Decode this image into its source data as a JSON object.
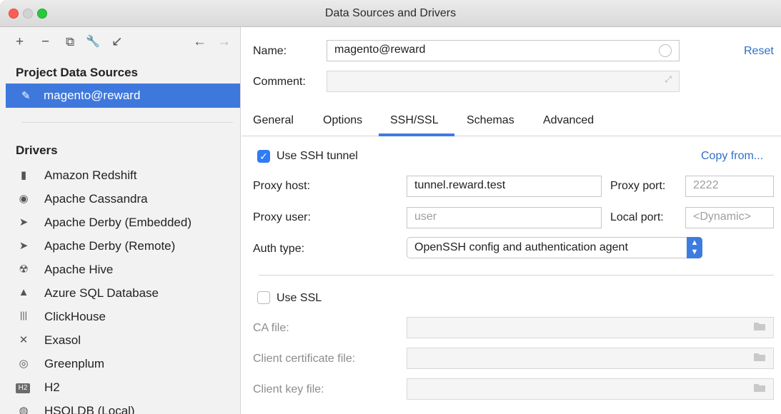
{
  "window": {
    "title": "Data Sources and Drivers"
  },
  "sidebar": {
    "toolbar": {
      "add": "+",
      "remove": "−",
      "copy": "⧉",
      "wrench": "🔧",
      "import": "↙",
      "back": "←",
      "forward": "→"
    },
    "project_heading": "Project Data Sources",
    "selected_item": {
      "icon": "✎",
      "name": "magento",
      "suffix": "@reward"
    },
    "drivers_heading": "Drivers",
    "drivers": [
      {
        "icon": "▮",
        "label": "Amazon Redshift"
      },
      {
        "icon": "◉",
        "label": "Apache Cassandra"
      },
      {
        "icon": "➤",
        "label": "Apache Derby (Embedded)"
      },
      {
        "icon": "➤",
        "label": "Apache Derby (Remote)"
      },
      {
        "icon": "☢",
        "label": "Apache Hive"
      },
      {
        "icon": "▲",
        "label": "Azure SQL Database"
      },
      {
        "icon": "|||",
        "label": "ClickHouse"
      },
      {
        "icon": "✕",
        "label": "Exasol"
      },
      {
        "icon": "◎",
        "label": "Greenplum"
      },
      {
        "icon": "H2",
        "label": "H2"
      },
      {
        "icon": "◍",
        "label": "HSQLDB (Local)"
      }
    ]
  },
  "main": {
    "name_label": "Name:",
    "name_value": "magento@reward",
    "reset": "Reset",
    "comment_label": "Comment:",
    "comment_value": "",
    "tabs": [
      {
        "label": "General"
      },
      {
        "label": "Options"
      },
      {
        "label": "SSH/SSL"
      },
      {
        "label": "Schemas"
      },
      {
        "label": "Advanced"
      }
    ],
    "ssh": {
      "use_ssh_label": "Use SSH tunnel",
      "use_ssh_checked": true,
      "copy_from": "Copy from...",
      "proxy_host_label": "Proxy host:",
      "proxy_host_value": "tunnel.reward.test",
      "proxy_port_label": "Proxy port:",
      "proxy_port_placeholder": "2222",
      "proxy_user_label": "Proxy user:",
      "proxy_user_placeholder": "user",
      "local_port_label": "Local port:",
      "local_port_placeholder": "<Dynamic>",
      "auth_type_label": "Auth type:",
      "auth_type_value": "OpenSSH config and authentication agent"
    },
    "ssl": {
      "use_ssl_label": "Use SSL",
      "use_ssl_checked": false,
      "ca_file_label": "CA file:",
      "client_cert_label": "Client certificate file:",
      "client_key_label": "Client key file:"
    }
  },
  "colors": {
    "accent": "#3f78dc",
    "link": "#2f6fc8",
    "checkbox_on": "#2f7cf6"
  }
}
